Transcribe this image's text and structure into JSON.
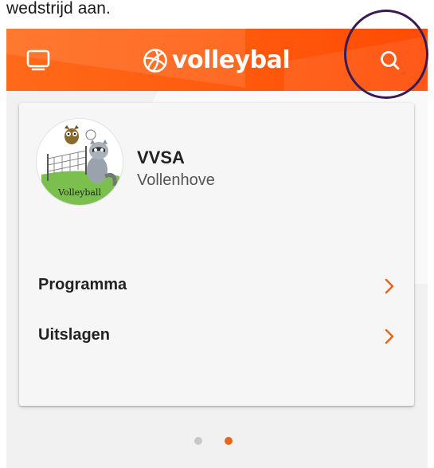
{
  "caption": {
    "text": "wedstrijd aan."
  },
  "header": {
    "logo_text": "volleybal",
    "icons": {
      "left": "tv-icon",
      "right": "search-icon",
      "logo": "volleyball-icon"
    },
    "accent": "#ff5a0c"
  },
  "club": {
    "name": "VVSA",
    "city": "Vollenhove",
    "logo_text": "Volleyball"
  },
  "menu": {
    "items": [
      {
        "label": "Programma"
      },
      {
        "label": "Uitslagen"
      }
    ],
    "chevron_color": "#e8661c"
  },
  "pager": {
    "pages": 2,
    "active_page": 2,
    "colors": {
      "inactive": "#c8c8c8",
      "active": "#e8661c"
    }
  },
  "annotation": {
    "color": "#3a1a55",
    "target": "search-icon"
  }
}
